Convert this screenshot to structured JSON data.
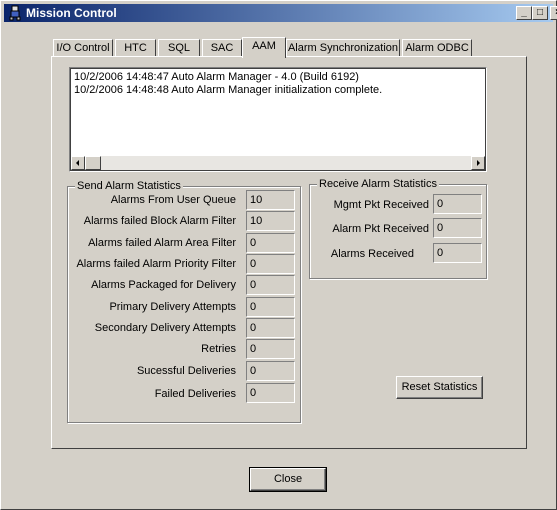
{
  "window": {
    "title": "Mission Control",
    "controls": {
      "minimize": "_",
      "maximize": "□",
      "close": "×"
    }
  },
  "tabs": [
    {
      "label": "I/O Control"
    },
    {
      "label": "HTC"
    },
    {
      "label": "SQL"
    },
    {
      "label": "SAC"
    },
    {
      "label": "AAM",
      "active": true
    },
    {
      "label": "Alarm Synchronization"
    },
    {
      "label": "Alarm ODBC"
    }
  ],
  "log": {
    "lines": [
      "10/2/2006 14:48:47 Auto Alarm Manager -  4.0 (Build 6192)",
      "10/2/2006 14:48:48 Auto Alarm Manager initialization complete."
    ],
    "scroll_left_arrow": "◀",
    "scroll_right_arrow": "▶"
  },
  "send_stats": {
    "title": "Send Alarm Statistics",
    "rows": [
      {
        "label": "Alarms From User Queue",
        "value": "10"
      },
      {
        "label": "Alarms failed Block Alarm Filter",
        "value": "10"
      },
      {
        "label": "Alarms failed Alarm Area Filter",
        "value": "0"
      },
      {
        "label": "Alarms failed Alarm Priority Filter",
        "value": "0"
      },
      {
        "label": "Alarms Packaged for Delivery",
        "value": "0"
      },
      {
        "label": "Primary Delivery Attempts",
        "value": "0"
      },
      {
        "label": "Secondary Delivery Attempts",
        "value": "0"
      },
      {
        "label": "Retries",
        "value": "0"
      },
      {
        "label": "Sucessful Deliveries",
        "value": "0"
      },
      {
        "label": "Failed Deliveries",
        "value": "0"
      }
    ]
  },
  "receive_stats": {
    "title": "Receive Alarm Statistics",
    "rows": [
      {
        "label": "Mgmt Pkt Received",
        "value": "0"
      },
      {
        "label": "Alarm Pkt Received",
        "value": "0"
      },
      {
        "label": "Alarms Received",
        "value": "0"
      }
    ]
  },
  "buttons": {
    "reset": "Reset Statistics",
    "close": "Close"
  }
}
